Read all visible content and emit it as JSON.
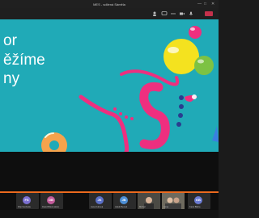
{
  "window": {
    "title": "MES - sdílená Sáměla",
    "controls": [
      "—",
      "□",
      "✕"
    ]
  },
  "slide": {
    "lines": [
      "or",
      "ěžíme",
      "ny"
    ]
  },
  "participants": [
    {
      "initials": "FS",
      "name": "Filip Svoboda",
      "color": "#7a6fd0"
    },
    {
      "initials": "DB",
      "name": "David Bílek (Host)",
      "color": "#c25a9a"
    },
    {
      "initials": "JK",
      "name": "Jana Kubová",
      "color": "#5a6fc8"
    },
    {
      "initials": "JB",
      "name": "Jakub Beneš",
      "color": "#4d8fd6"
    },
    {
      "initials": "",
      "name": "Michal",
      "color": ""
    },
    {
      "initials": "",
      "name": "Anna",
      "color": ""
    },
    {
      "initials": "KB",
      "name": "Karel Bláha",
      "color": "#6a7ad2"
    }
  ],
  "colors": {
    "slide_bg": "#20aab7",
    "pink": "#ee2f7f",
    "orange": "#ec6a1e",
    "yellow": "#f4e21f"
  }
}
